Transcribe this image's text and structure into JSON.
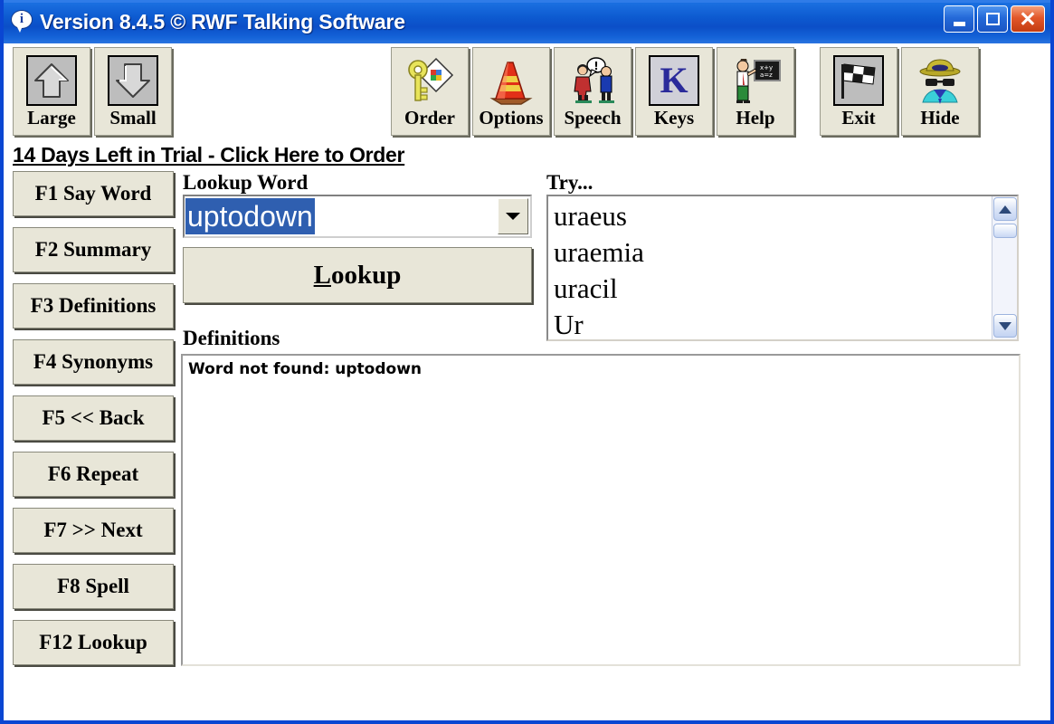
{
  "window": {
    "title": "Version 8.4.5 © RWF Talking Software",
    "icon": "info-bubble-icon",
    "controls": {
      "minimize": "minimize-icon",
      "maximize": "maximize-icon",
      "close": "close-icon"
    },
    "border_color": "#0a46d2",
    "titlebar_color": "#0d5ad0"
  },
  "toolbar": {
    "buttons": [
      {
        "label": "Large",
        "icon": "arrow-up-icon"
      },
      {
        "label": "Small",
        "icon": "arrow-down-icon"
      },
      {
        "label": "Order",
        "icon": "key-icon"
      },
      {
        "label": "Options",
        "icon": "traffic-cone-icon"
      },
      {
        "label": "Speech",
        "icon": "two-people-talking-icon"
      },
      {
        "label": "Keys",
        "icon": "letter-k-icon"
      },
      {
        "label": "Help",
        "icon": "teacher-blackboard-icon"
      },
      {
        "label": "Exit",
        "icon": "checkered-flag-icon"
      },
      {
        "label": "Hide",
        "icon": "disguise-icon"
      }
    ]
  },
  "trial": {
    "notice": "14 Days Left in Trial - Click Here to Order"
  },
  "function_keys": [
    "F1 Say Word",
    "F2 Summary",
    "F3 Definitions",
    "F4 Synonyms",
    "F5 << Back",
    "F6 Repeat",
    "F7 >> Next",
    "F8 Spell",
    "F12 Lookup"
  ],
  "lookup": {
    "label": "Lookup Word",
    "value": "uptodown",
    "selected": true,
    "selection_color": "#2f5fb0",
    "dropdown_icon": "chevron-down-icon",
    "button_label_prefix": "L",
    "button_label_rest": "ookup"
  },
  "try": {
    "label": "Try...",
    "items": [
      "uraeus",
      "uraemia",
      "uracil",
      "Ur"
    ],
    "scrollbar": {
      "up_icon": "chevron-up-icon",
      "down_icon": "chevron-down-icon"
    }
  },
  "definitions": {
    "label": "Definitions",
    "text": "Word not found: uptodown"
  }
}
